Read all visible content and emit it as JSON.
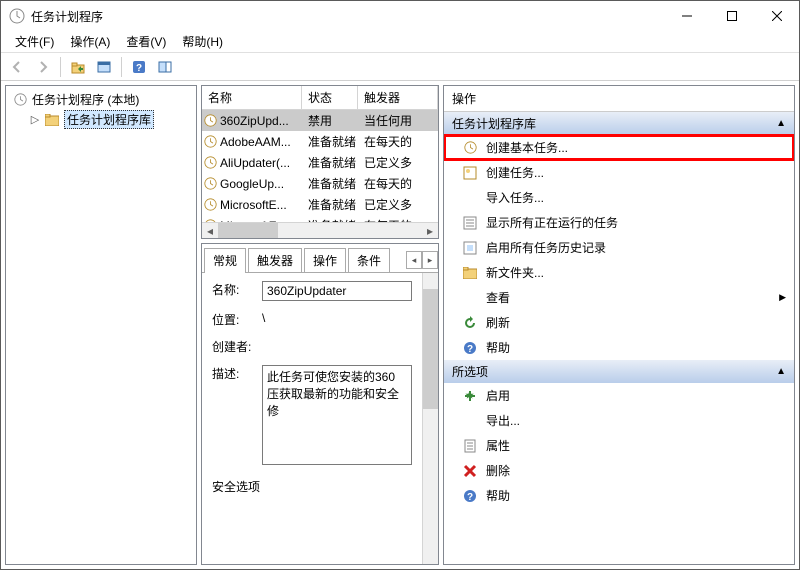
{
  "titlebar": {
    "text": "任务计划程序"
  },
  "menu": {
    "file": "文件(F)",
    "action": "操作(A)",
    "view": "查看(V)",
    "help": "帮助(H)"
  },
  "tree": {
    "root": "任务计划程序 (本地)",
    "child": "任务计划程序库"
  },
  "columns": {
    "name": "名称",
    "status": "状态",
    "trigger": "触发器"
  },
  "tasks": [
    {
      "name": "360ZipUpd...",
      "status": "禁用",
      "trigger": "当任何用"
    },
    {
      "name": "AdobeAAM...",
      "status": "准备就绪",
      "trigger": "在每天的"
    },
    {
      "name": "AliUpdater(...",
      "status": "准备就绪",
      "trigger": "已定义多"
    },
    {
      "name": "GoogleUp...",
      "status": "准备就绪",
      "trigger": "在每天的"
    },
    {
      "name": "MicrosoftE...",
      "status": "准备就绪",
      "trigger": "已定义多"
    },
    {
      "name": "MicrosoftE...",
      "status": "准备就绪",
      "trigger": "在每天的"
    }
  ],
  "tabs": {
    "general": "常规",
    "triggers": "触发器",
    "actions": "操作",
    "conditions": "条件"
  },
  "detail": {
    "name_label": "名称:",
    "name_value": "360ZipUpdater",
    "location_label": "位置:",
    "location_value": "\\",
    "author_label": "创建者:",
    "author_value": "",
    "desc_label": "描述:",
    "desc_value": "此任务可使您安装的360压获取最新的功能和安全修",
    "secopts": "安全选项"
  },
  "actions": {
    "header": "操作",
    "section1": "任务计划程序库",
    "create_basic": "创建基本任务...",
    "create_task": "创建任务...",
    "import_task": "导入任务...",
    "show_running": "显示所有正在运行的任务",
    "enable_history": "启用所有任务历史记录",
    "new_folder": "新文件夹...",
    "view": "查看",
    "refresh": "刷新",
    "help": "帮助",
    "section2": "所选项",
    "enable": "启用",
    "export": "导出...",
    "properties": "属性",
    "delete": "删除",
    "help2": "帮助"
  }
}
